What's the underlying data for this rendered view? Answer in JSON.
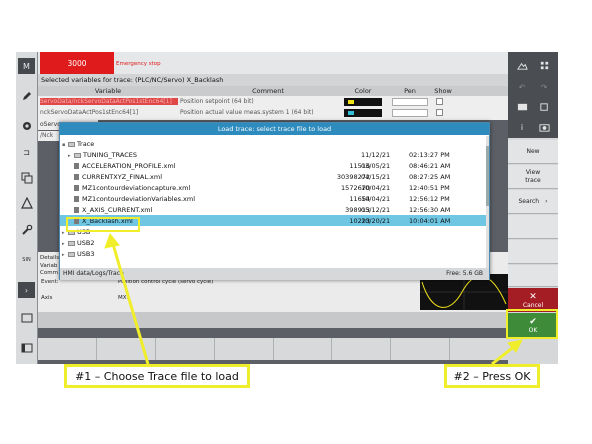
{
  "alarm": {
    "number": "3000",
    "text": "Emergency stop"
  },
  "trace_header": "Selected variables for trace:  (PLC/NC/Servo) X_Backlash",
  "table": {
    "columns": [
      "Variable",
      "Comment",
      "Color",
      "Pen",
      "Show"
    ],
    "rows": [
      {
        "variable": "ServoData/nckServoDataActPos1stEnc64[1]",
        "comment": "Position setpoint (64 bit)",
        "color": "#f2e21a"
      },
      {
        "variable": "nckServoDataActPos1stEnc64[1]",
        "comment": "Position actual value meas.system 1 (64 bit)",
        "color": "#31c0d8"
      },
      {
        "variable": "/Nck",
        "comment": "",
        "color": ""
      }
    ],
    "side_vars": [
      "oServo",
      "/Nck"
    ]
  },
  "dialog": {
    "title": "Load trace: select trace file to load",
    "items": [
      {
        "name": "Trace",
        "type": "folder-open",
        "size": "",
        "date": "",
        "time": ""
      },
      {
        "name": "TUNING_TRACES",
        "type": "folder",
        "size": "",
        "date": "11/12/21",
        "time": "02:13:27 PM"
      },
      {
        "name": "ACCELERATION_PROFILE.xml",
        "type": "file",
        "size": "11516",
        "date": "03/05/21",
        "time": "08:46:21 AM"
      },
      {
        "name": "CURRENTXYZ_FINAL.xml",
        "type": "file",
        "size": "30398272",
        "date": "04/15/21",
        "time": "08:27:25 AM"
      },
      {
        "name": "MZ1contourdeviationcapture.xml",
        "type": "file",
        "size": "1572670",
        "date": "10/04/21",
        "time": "12:40:51 PM"
      },
      {
        "name": "MZ1contourdeviationVariables.xml",
        "type": "file",
        "size": "11654",
        "date": "10/04/21",
        "time": "12:56:12 PM"
      },
      {
        "name": "X_AXIS_CURRENT.xml",
        "type": "file",
        "size": "398913",
        "date": "05/12/21",
        "time": "12:56:30 AM"
      },
      {
        "name": "X_Backlash.xml",
        "type": "file",
        "size": "10223",
        "date": "10/20/21",
        "time": "10:04:01 AM",
        "selected": true
      },
      {
        "name": "USB",
        "type": "folder",
        "size": "",
        "date": "",
        "time": ""
      },
      {
        "name": "USB2",
        "type": "folder",
        "size": "",
        "date": "",
        "time": ""
      },
      {
        "name": "USB3",
        "type": "folder",
        "size": "",
        "date": "",
        "time": ""
      }
    ],
    "path": "HMI data/Logs/Trace",
    "free": "Free: 5.6 GB"
  },
  "details": {
    "label": "Details",
    "event_label": "Event:",
    "event_value": "Position control cycle (servo cycle)",
    "axis_label": "Axis",
    "axis_value": "MX1",
    "side_labels": [
      "Variab",
      "Comm"
    ]
  },
  "softkeys": {
    "new": "New",
    "view_trace": "View\ntrace",
    "search": "Search",
    "cancel": "Cancel",
    "ok": "OK"
  },
  "annotations": {
    "step1": "#1 – Choose Trace file to load",
    "step2": "#2 – Press OK"
  },
  "colors": {
    "accent_blue": "#2d8bbd",
    "selection": "#6ec6e2",
    "alarm_red": "#e01b1b",
    "ok_green": "#3e8c3a",
    "cancel_red": "#a51d24",
    "highlight_yellow": "#f0ee2a"
  }
}
